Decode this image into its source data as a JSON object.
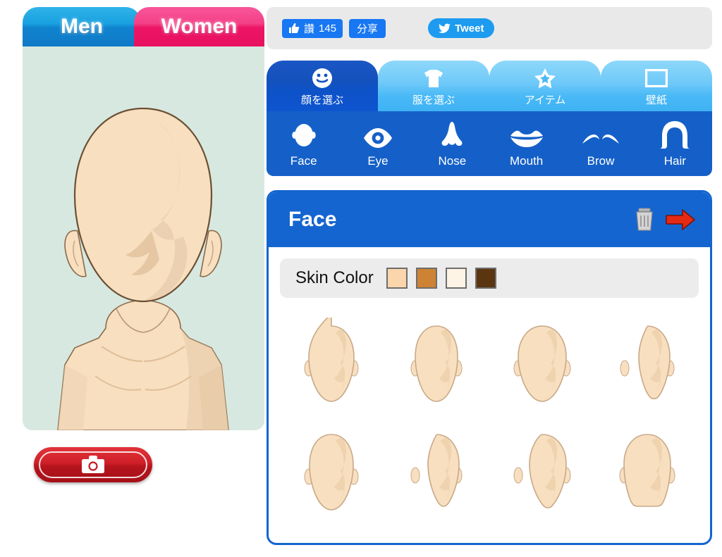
{
  "gender_tabs": [
    {
      "label": "Men",
      "active": true,
      "color": "#1184cf"
    },
    {
      "label": "Women",
      "active": false,
      "color": "#ec1566"
    }
  ],
  "avatar_preview": {
    "background_color": "#d7e8e0",
    "skin_color": "#f7dfc0",
    "outline_color": "#8a6a4a"
  },
  "camera_button": {
    "icon": "camera-icon",
    "color": "#c01b23"
  },
  "social": {
    "like_label": "讚",
    "like_count": "145",
    "share_label": "分享",
    "tweet_label": "Tweet",
    "facebook_color": "#1877f2",
    "twitter_color": "#1d9bf0"
  },
  "main_tabs": [
    {
      "label": "顔を選ぶ",
      "icon": "smiley-face-icon",
      "active": true
    },
    {
      "label": "服を選ぶ",
      "icon": "tshirt-icon",
      "active": false
    },
    {
      "label": "アイテム",
      "icon": "star-icon",
      "active": false
    },
    {
      "label": "壁紙",
      "icon": "wallpaper-frame-icon",
      "active": false
    }
  ],
  "sub_nav": [
    {
      "label": "Face",
      "icon": "face-icon"
    },
    {
      "label": "Eye",
      "icon": "eye-icon"
    },
    {
      "label": "Nose",
      "icon": "nose-icon"
    },
    {
      "label": "Mouth",
      "icon": "mouth-icon"
    },
    {
      "label": "Brow",
      "icon": "brow-icon"
    },
    {
      "label": "Hair",
      "icon": "hair-icon"
    }
  ],
  "panel": {
    "title": "Face",
    "accent_color": "#1565d0",
    "trash_icon": "trash-icon",
    "next_arrow_icon": "right-arrow-icon",
    "skin_color_label": "Skin Color",
    "skin_swatches": [
      {
        "name": "light-peach",
        "hex": "#fbd5ab"
      },
      {
        "name": "tan",
        "hex": "#cd8333"
      },
      {
        "name": "ivory",
        "hex": "#fdf4e6"
      },
      {
        "name": "dark-brown",
        "hex": "#5b3510"
      }
    ],
    "face_options": [
      {
        "id": "face-1",
        "shape": "oval"
      },
      {
        "id": "face-2",
        "shape": "oval-narrow"
      },
      {
        "id": "face-3",
        "shape": "round"
      },
      {
        "id": "face-4",
        "shape": "square-jaw"
      },
      {
        "id": "face-5",
        "shape": "long-oval"
      },
      {
        "id": "face-6",
        "shape": "diamond"
      },
      {
        "id": "face-7",
        "shape": "pointed-chin"
      },
      {
        "id": "face-8",
        "shape": "wide-square"
      }
    ]
  }
}
